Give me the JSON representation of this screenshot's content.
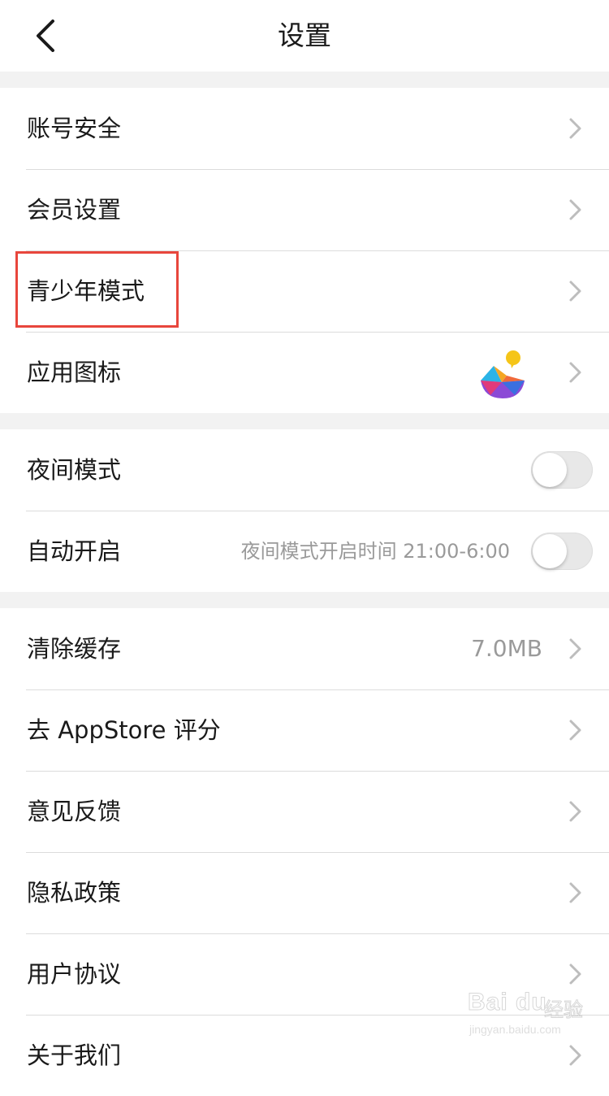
{
  "header": {
    "title": "设置",
    "back_icon": "chevron-left-icon"
  },
  "groups": [
    {
      "items": [
        {
          "label": "账号安全",
          "accessory": "chevron-right-icon"
        },
        {
          "label": "会员设置",
          "accessory": "chevron-right-icon"
        },
        {
          "label": "青少年模式",
          "accessory": "chevron-right-icon",
          "highlighted": true
        },
        {
          "label": "应用图标",
          "accessory": "chevron-right-icon",
          "icon": "app-logo-icon"
        }
      ]
    },
    {
      "items": [
        {
          "label": "夜间模式",
          "toggle": false
        },
        {
          "label": "自动开启",
          "subtitle": "夜间模式开启时间 21:00-6:00",
          "toggle": false
        }
      ]
    },
    {
      "items": [
        {
          "label": "清除缓存",
          "value": "7.0MB",
          "accessory": "chevron-right-icon"
        },
        {
          "label": "去 AppStore 评分",
          "accessory": "chevron-right-icon"
        },
        {
          "label": "意见反馈",
          "accessory": "chevron-right-icon"
        },
        {
          "label": "隐私政策",
          "accessory": "chevron-right-icon"
        },
        {
          "label": "用户协议",
          "accessory": "chevron-right-icon"
        },
        {
          "label": "关于我们",
          "accessory": "chevron-right-icon"
        }
      ]
    }
  ],
  "watermark": {
    "brand": "Bai du",
    "text": "经验",
    "url": "jingyan.baidu.com"
  },
  "colors": {
    "background": "#f2f2f2",
    "highlight_border": "#e8463c",
    "secondary_text": "#9a9a9a"
  }
}
